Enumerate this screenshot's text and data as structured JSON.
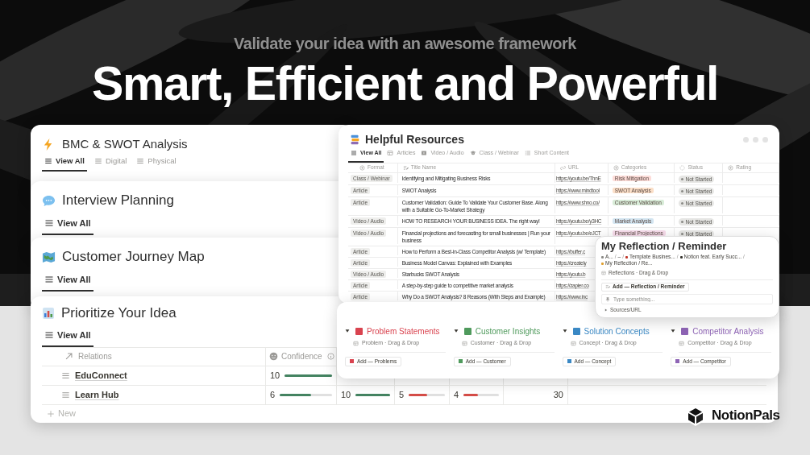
{
  "headline": {
    "subtitle": "Validate your idea with an awesome framework",
    "title": "Smart, Efficient and Powerful"
  },
  "pages": [
    {
      "title": "BMC & SWOT Analysis",
      "tabs": [
        {
          "label": "View All",
          "selected": true
        },
        {
          "label": "Digital",
          "selected": false
        },
        {
          "label": "Physical",
          "selected": false
        }
      ]
    },
    {
      "title": "Interview Planning",
      "tabs": [
        {
          "label": "View All",
          "selected": true
        }
      ]
    },
    {
      "title": "Customer Journey Map",
      "tabs": [
        {
          "label": "View All",
          "selected": true
        }
      ]
    }
  ],
  "prioritize": {
    "title": "Prioritize Your Idea",
    "tabs": [
      {
        "label": "View All",
        "selected": true
      }
    ],
    "columns": [
      "Relations",
      "Confidence"
    ],
    "rows": [
      {
        "name": "EduConnect",
        "cells": [
          {
            "kind": "meter",
            "value": "10",
            "level": 1,
            "color": "#448361"
          }
        ]
      },
      {
        "name": "Learn Hub",
        "cells": [
          {
            "kind": "meter",
            "value": "6",
            "level": 0.6,
            "color": "#448361"
          },
          {
            "kind": "meter",
            "value": "10",
            "level": 1,
            "color": "#448361"
          },
          {
            "kind": "meter",
            "value": "5",
            "level": 0.5,
            "color": "#d44c47"
          },
          {
            "kind": "meter",
            "value": "4",
            "level": 0.4,
            "color": "#d44c47"
          },
          {
            "kind": "number",
            "value": "30"
          }
        ]
      }
    ],
    "new_label": "New"
  },
  "resources": {
    "title": "Helpful Resources",
    "tabs": [
      {
        "label": "View All",
        "selected": true
      },
      {
        "label": "Articles",
        "selected": false
      },
      {
        "label": "Video / Audio",
        "selected": false
      },
      {
        "label": "Class / Webinar",
        "selected": false
      },
      {
        "label": "Short Content",
        "selected": false
      }
    ],
    "columns": [
      "Format",
      "Title Name",
      "URL",
      "Categories",
      "Status",
      "Rating"
    ],
    "rows": [
      {
        "format": "Class / Webinar",
        "title": "Identifying and Mitigating Business Risks",
        "url": "https://youtu.be/ThnE",
        "category": {
          "label": "Risk Mitigation",
          "color": "#fddcd8"
        },
        "status": "Not Started"
      },
      {
        "format": "Article",
        "title": "SWOT Analysis",
        "url": "https://www.mindtool",
        "category": {
          "label": "SWOT Analysis",
          "color": "#fbdfc8"
        },
        "status": "Not Started"
      },
      {
        "format": "Article",
        "title": "Customer Validation: Guide To Validate Your Customer Base. Along with a Suitable Go-To-Market Strategy",
        "url": "https://www.shno.co/",
        "category": {
          "label": "Customer Validation",
          "color": "#d8ecd8"
        },
        "status": "Not Started"
      },
      {
        "format": "Video / Audio",
        "title": "HOW TO RESEARCH YOUR BUSINESS IDEA. The right way!",
        "url": "https://youtu.be/y3HC",
        "category": {
          "label": "Market Analysis",
          "color": "#d3e5f1"
        },
        "status": "Not Started"
      },
      {
        "format": "Video / Audio",
        "title": "Financial projections and forecasting for small businesses | Run your business",
        "url": "https://youtu.be/eJCT",
        "category": {
          "label": "Financial Projections",
          "color": "#f7dceb"
        },
        "status": "Not Started"
      },
      {
        "format": "Article",
        "title": "How to Perform a Best-in-Class Competitor Analysis (w/ Template)",
        "url": "https://buffer.c"
      },
      {
        "format": "Article",
        "title": "Business Model Canvas: Explained with Examples",
        "url": "https://creately"
      },
      {
        "format": "Video / Audio",
        "title": "Starbucks SWOT Analysis",
        "url": "https://youtu.b"
      },
      {
        "format": "Article",
        "title": "A step-by-step guide to competitive market analysis",
        "url": "https://zapier.co"
      },
      {
        "format": "Article",
        "title": "Why Do a SWOT Analysis? 8 Reasons (With Steps and Example)",
        "url": "https://www.inc"
      }
    ]
  },
  "reflection": {
    "title": "My Reflection / Reminder",
    "separator": "/",
    "breadcrumbs": [
      "A...",
      "–",
      "Template Busines...",
      "Notion feat. Early Succ...",
      "My Reflection / Re..."
    ],
    "view": "Reflections · Drag & Drop",
    "add_button": "Add — Reflection / Reminder",
    "input": {
      "placeholder": "Type something..."
    },
    "toggle": "Sources/URL"
  },
  "board": {
    "groups": [
      {
        "title": "Problem Statements",
        "color": "#d9434f",
        "view": "Problem · Drag & Drop",
        "add": "Add — Problems"
      },
      {
        "title": "Customer Insights",
        "color": "#4f9a5c",
        "view": "Customer · Drag & Drop",
        "add": "Add — Customer"
      },
      {
        "title": "Solution Concepts",
        "color": "#3a88c4",
        "view": "Concept · Drag & Drop",
        "add": "Add — Concept"
      },
      {
        "title": "Competitor Analysis",
        "color": "#8e64b5",
        "view": "Competitor · Drag & Drop",
        "add": "Add — Competitor"
      }
    ]
  },
  "logo": {
    "text": "NotionPals"
  }
}
